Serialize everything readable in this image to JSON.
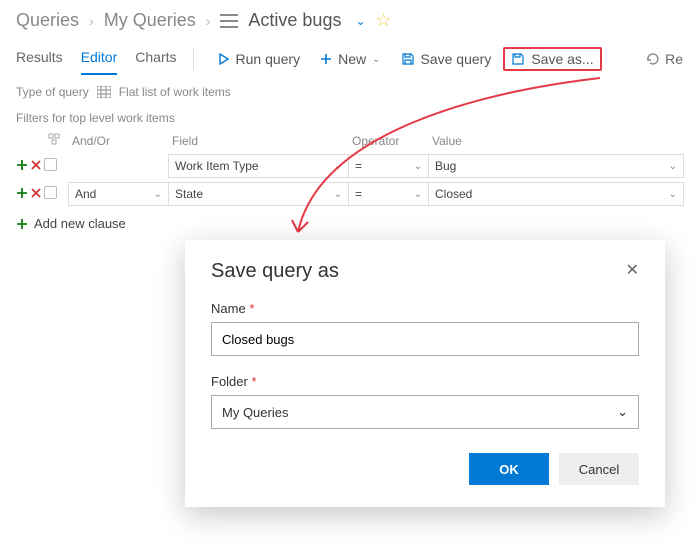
{
  "breadcrumb": {
    "root": "Queries",
    "folder": "My Queries",
    "current": "Active bugs"
  },
  "tabs": {
    "results": "Results",
    "editor": "Editor",
    "charts": "Charts"
  },
  "toolbar": {
    "run": "Run query",
    "new": "New",
    "save": "Save query",
    "save_as": "Save as...",
    "revert_short": "Re"
  },
  "subbar": {
    "type_label": "Type of query",
    "type_value": "Flat list of work items"
  },
  "filters": {
    "heading": "Filters for top level work items",
    "cols": {
      "andor": "And/Or",
      "field": "Field",
      "operator": "Operator",
      "value": "Value"
    },
    "rows": [
      {
        "andor": "",
        "field": "Work Item Type",
        "op": "=",
        "value": "Bug"
      },
      {
        "andor": "And",
        "field": "State",
        "op": "=",
        "value": "Closed"
      }
    ],
    "add": "Add new clause"
  },
  "dialog": {
    "title": "Save query as",
    "name_label": "Name",
    "name_value": "Closed bugs",
    "folder_label": "Folder",
    "folder_value": "My Queries",
    "ok": "OK",
    "cancel": "Cancel"
  }
}
